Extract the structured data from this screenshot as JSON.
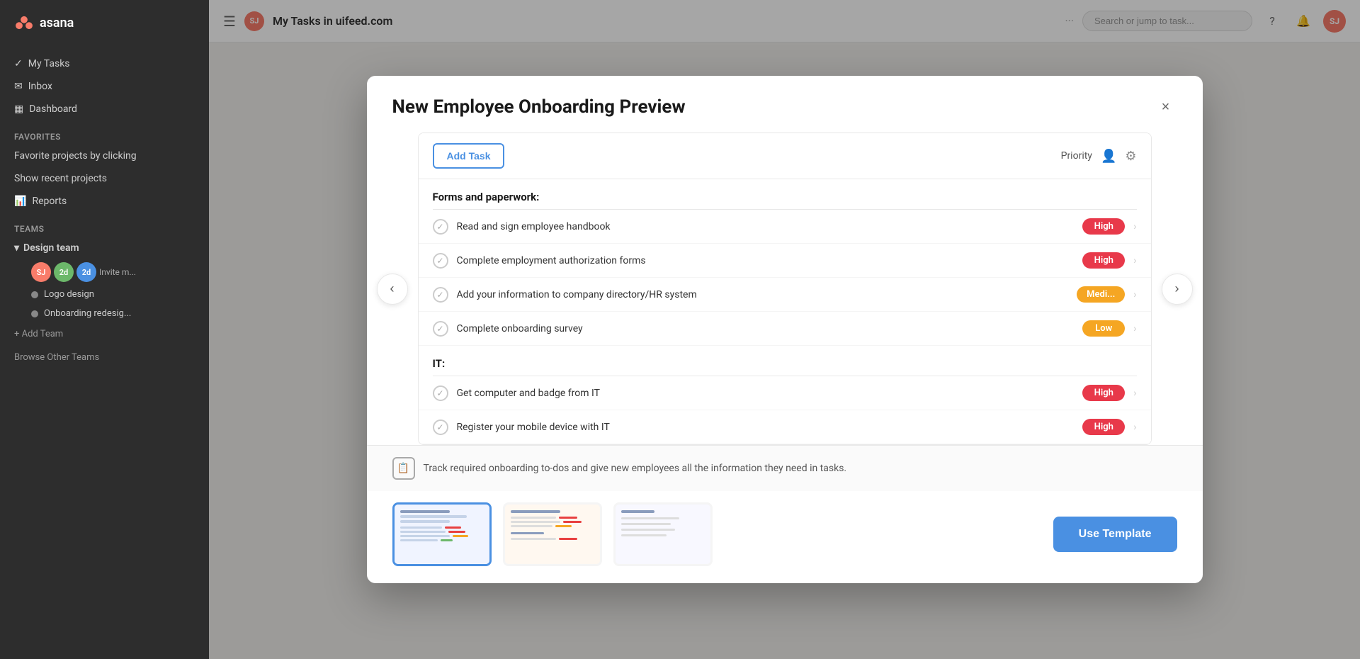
{
  "app": {
    "name": "asana",
    "logo_text": "asana"
  },
  "sidebar": {
    "nav_items": [
      {
        "label": "My Tasks",
        "icon": "tasks-icon"
      },
      {
        "label": "Inbox",
        "icon": "inbox-icon"
      },
      {
        "label": "Dashboard",
        "icon": "dashboard-icon"
      }
    ],
    "sections": {
      "favorites_label": "Favorites",
      "favorites_sub": "Favorite projects by clicking",
      "show_recent": "Show recent projects",
      "reports_label": "Reports",
      "teams_label": "Teams",
      "design_team_label": "Design team",
      "invite_label": "Invite m...",
      "projects": [
        {
          "label": "Logo design",
          "color": "#888"
        },
        {
          "label": "Onboarding redesig...",
          "color": "#888"
        }
      ],
      "add_team_label": "+ Add Team",
      "browse_teams_label": "Browse Other Teams"
    }
  },
  "topbar": {
    "menu_icon": "☰",
    "avatar_initials": "SJ",
    "title": "My Tasks in uifeed.com",
    "more_icon": "···",
    "search_placeholder": "Search or jump to task...",
    "right_icons": [
      "help-icon",
      "notification-icon"
    ],
    "user_initials": "SJ"
  },
  "modal": {
    "title": "New Employee Onboarding Preview",
    "close_label": "×",
    "toolbar": {
      "add_task_label": "Add Task",
      "priority_label": "Priority",
      "person_icon": "👤",
      "filter_icon": "⚙"
    },
    "sections": [
      {
        "name": "forms_section",
        "title": "Forms and paperwork:",
        "tasks": [
          {
            "name": "Read and sign employee handbook",
            "priority": "High",
            "priority_type": "high"
          },
          {
            "name": "Complete employment authorization forms",
            "priority": "High",
            "priority_type": "high"
          },
          {
            "name": "Add your information to company directory/HR system",
            "priority": "Medi...",
            "priority_type": "medium"
          },
          {
            "name": "Complete onboarding survey",
            "priority": "Low",
            "priority_type": "low"
          }
        ]
      },
      {
        "name": "it_section",
        "title": "IT:",
        "tasks": [
          {
            "name": "Get computer and badge from IT",
            "priority": "High",
            "priority_type": "high"
          },
          {
            "name": "Register your mobile device with IT",
            "priority": "High",
            "priority_type": "high"
          }
        ]
      }
    ],
    "info_text": "Track required onboarding to-dos and give new employees all the information they need in tasks.",
    "use_template_label": "Use Template",
    "thumbnails": [
      {
        "label": "thumb-1",
        "active": true
      },
      {
        "label": "thumb-2",
        "active": false
      },
      {
        "label": "thumb-3",
        "active": false
      }
    ],
    "nav_prev": "‹",
    "nav_next": "›"
  }
}
